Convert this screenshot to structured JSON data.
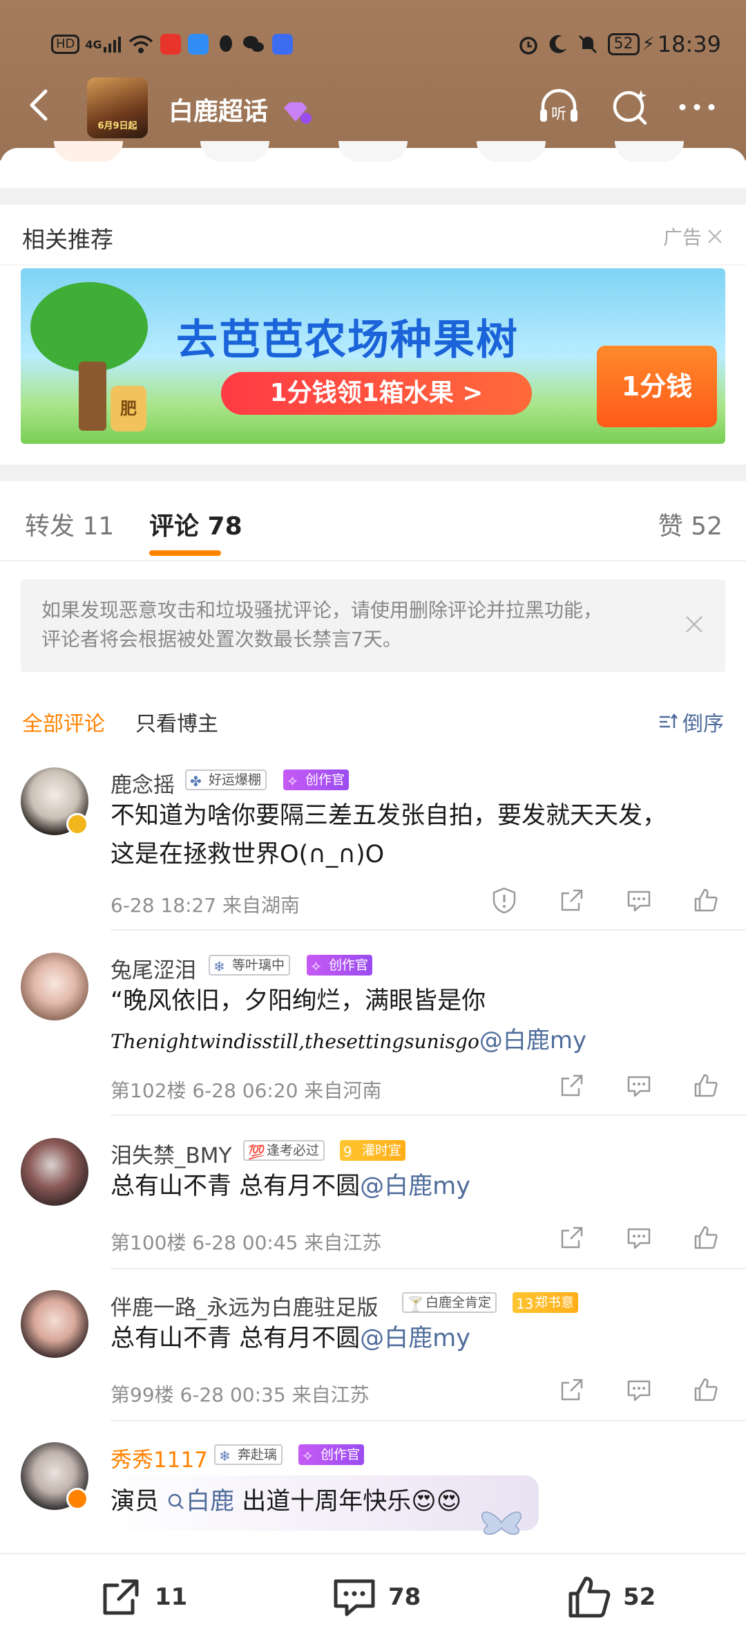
{
  "status_bar": {
    "left_icons": [
      "HD",
      "4G"
    ],
    "battery": "52",
    "time": "18:39"
  },
  "nav": {
    "title": "白鹿超话",
    "avatar_caption": "6月9日起"
  },
  "recommend": {
    "title": "相关推荐",
    "ad_label": "广告"
  },
  "banner": {
    "title": "去芭芭农场种果树",
    "button": "1分钱领1箱水果 >",
    "box_label": "1分钱",
    "bag_label": "肥"
  },
  "tabs": {
    "repost": "转发 11",
    "comment": "评论 78",
    "like": "赞 52"
  },
  "notice": {
    "line1": "如果发现恶意攻击和垃圾骚扰评论，请使用删除评论并拉黑功能，",
    "line2": "评论者将会根据被处置次数最长禁言7天。"
  },
  "filters": {
    "all": "全部评论",
    "blogger": "只看博主",
    "sort": "倒序"
  },
  "comments": [
    {
      "name": "鹿念摇",
      "medal": "好运爆棚",
      "badge": "创作官",
      "text_line1": "不知道为啥你要隔三差五发张自拍，要发就天天发，",
      "text_line2": "这是在拯救世界O(∩_∩)O",
      "meta": "6-28 18:27  来自湖南"
    },
    {
      "name": "兔尾涩泪",
      "medal": "等叶璃中",
      "badge": "创作官",
      "text_line1": "“晚风依旧，夕阳绚烂，满眼皆是你",
      "script_text": "Thenightwindisstill,thesettingsunisgo",
      "mention": "@白鹿my",
      "meta": "第102楼  6-28 06:20  来自河南"
    },
    {
      "name": "泪失禁_BMY",
      "medal": "逢考必过",
      "badge": "灌时宜",
      "badge_level": "9",
      "text": "总有山不青 总有月不圆",
      "mention": "@白鹿my",
      "meta": "第100楼  6-28 00:45  来自江苏"
    },
    {
      "name": "伴鹿一路_永远为白鹿驻足版",
      "medal": "白鹿全肯定",
      "badge": "郑书意",
      "badge_level": "13",
      "text": "总有山不青 总有月不圆",
      "mention": "@白鹿my",
      "meta": "第99楼  6-28 00:35  来自江苏"
    },
    {
      "name": "秀秀1117",
      "medal": "奔赴璃",
      "badge": "创作官",
      "text_prefix": "演员 ",
      "topic": "白鹿",
      "text_suffix": " 出道十周年快乐😍😍"
    }
  ],
  "bottom_bar": {
    "repost_count": "11",
    "comment_count": "78",
    "like_count": "52"
  },
  "colors": {
    "header": "#a57d5d",
    "accent": "#ff8200",
    "mention": "#4f6c9b",
    "creator_badge": "#b04ff2"
  }
}
